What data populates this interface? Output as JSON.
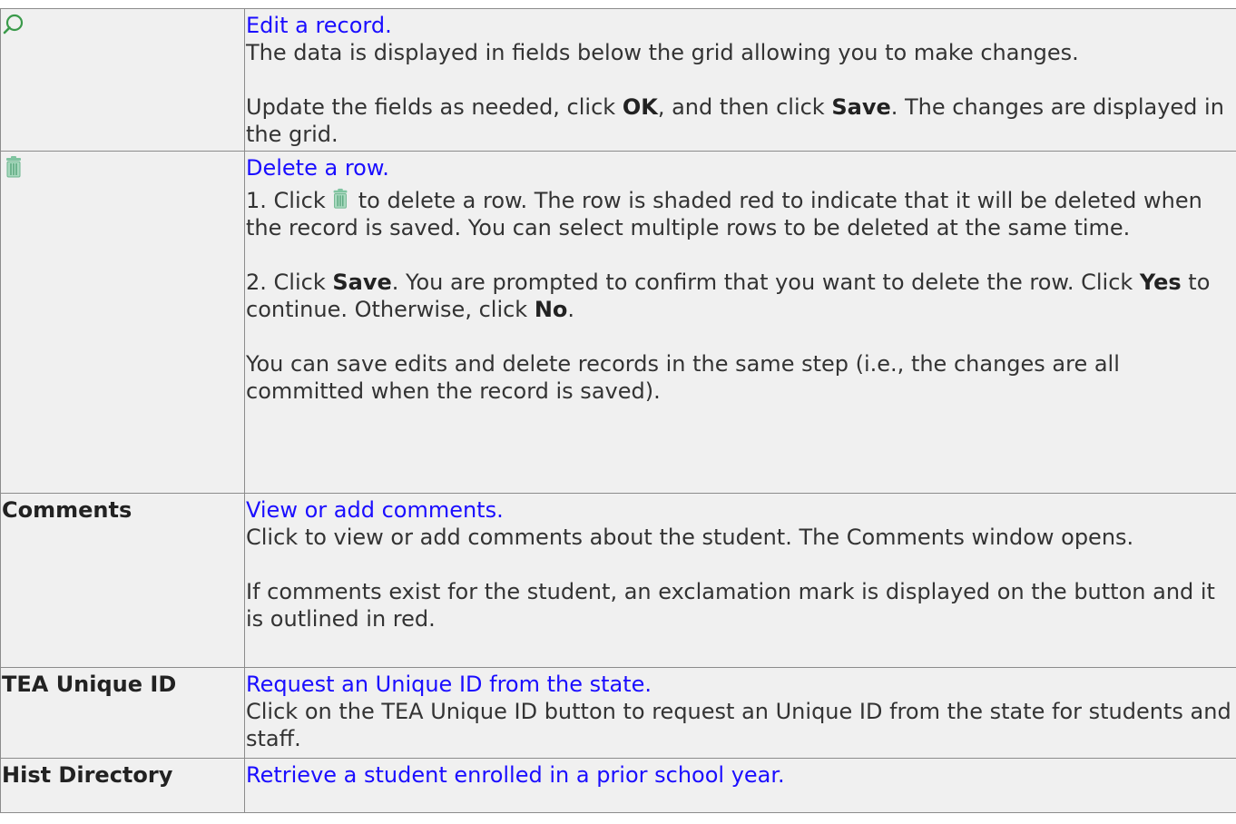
{
  "rows": [
    {
      "label": "",
      "icon": "magnifier-icon",
      "link": "Edit a record.",
      "desc1": "The data is displayed in fields below the grid allowing you to make changes.",
      "desc2_pre": "Update the fields as needed, click ",
      "desc2_b1": "OK",
      "desc2_mid": ", and then click ",
      "desc2_b2": "Save",
      "desc2_post": ". The changes are displayed in the grid."
    },
    {
      "label": "",
      "icon": "trash-icon",
      "link": "Delete a row.",
      "p1_pre": "1. Click",
      "p1_post": "to delete a row. The row is shaded red to indicate that it will be deleted when the record is saved. You can select multiple rows to be deleted at the same time.",
      "p2_pre": "2. Click ",
      "p2_b1": "Save",
      "p2_mid": ". You are prompted to confirm that you want to delete the row. Click ",
      "p2_b2": "Yes",
      "p2_mid2": " to continue. Otherwise, click ",
      "p2_b3": "No",
      "p2_post": ".",
      "p3": "You can save edits and delete records in the same step (i.e., the changes are all committed when the record is saved)."
    },
    {
      "label": "Comments",
      "link": "View or add comments.",
      "desc1": "Click to view or add comments about the student. The Comments window opens.",
      "desc2": "If comments exist for the student, an exclamation mark is displayed on the button and it is outlined in red."
    },
    {
      "label": "TEA Unique ID",
      "link": "Request an Unique ID from the state.",
      "desc1": "Click on the TEA Unique ID button to request an Unique ID from the state for students and staff."
    },
    {
      "label": "Hist Directory",
      "link": "Retrieve a student enrolled in a prior school year."
    }
  ],
  "colors": {
    "link": "#1a0dff",
    "cell_bg": "#f0f0f0",
    "border": "#8c8c8c",
    "icon": "#2e8b57"
  }
}
